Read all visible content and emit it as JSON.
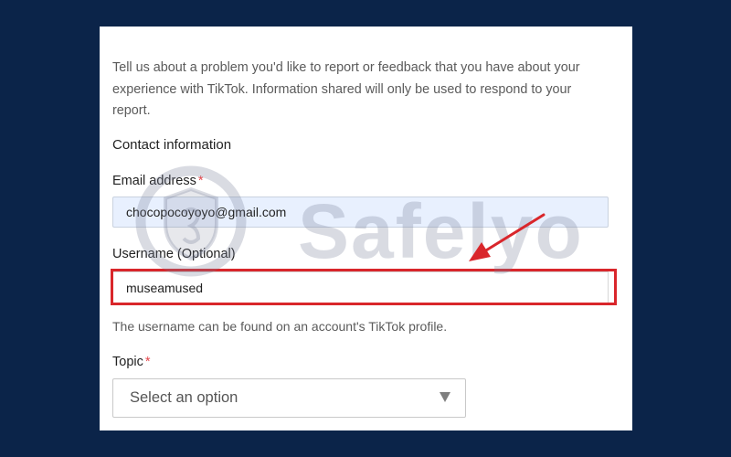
{
  "form": {
    "intro": "Tell us about a problem you'd like to report or feedback that you have about your experience with TikTok. Information shared will only be used to respond to your report.",
    "section_heading": "Contact information",
    "email": {
      "label": "Email address",
      "required_mark": "*",
      "value": "chocopocoyoyo@gmail.com"
    },
    "username": {
      "label": "Username (Optional)",
      "value": "museamused",
      "hint": "The username can be found on an account's TikTok profile."
    },
    "topic": {
      "label": "Topic",
      "required_mark": "*",
      "placeholder": "Select an option"
    }
  },
  "watermark": {
    "text": "Safelyo"
  },
  "colors": {
    "page_background": "#0b2449",
    "panel_background": "#ffffff",
    "highlight": "#d9262b",
    "required": "#e5484d",
    "autofill": "#e8f0fe"
  },
  "icons": {
    "watermark_logo": "shield-logo-icon",
    "annotation_arrow": "red-arrow-icon",
    "dropdown_caret": "triangle-down-icon"
  }
}
